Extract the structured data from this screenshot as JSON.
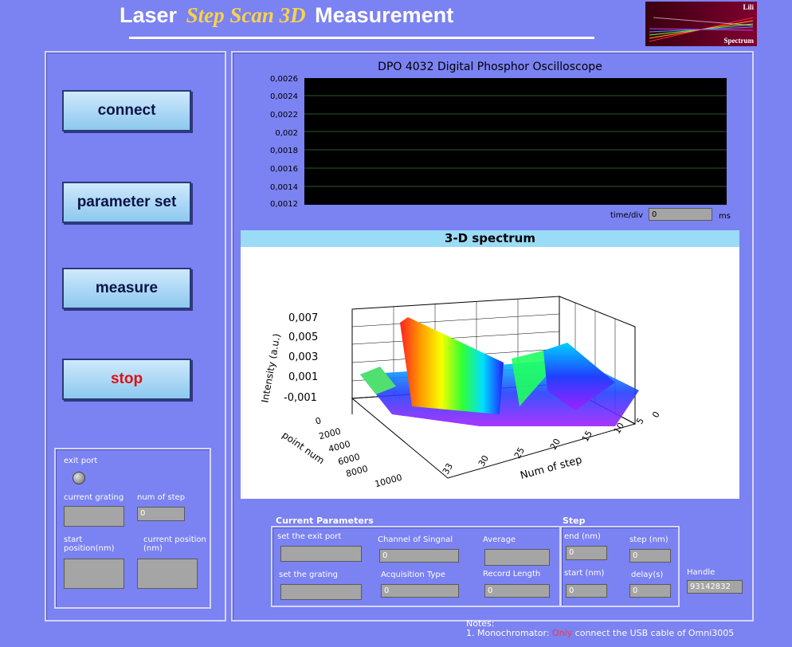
{
  "title": {
    "part1": "Laser",
    "part2": "Step Scan 3D",
    "part3": "Measurement"
  },
  "logo": {
    "line1": "Lili",
    "line2": "Spectrum"
  },
  "buttons": {
    "connect": "connect",
    "parameter_set": "parameter set",
    "measure": "measure",
    "stop": "stop"
  },
  "status": {
    "exit_port_label": "exit port",
    "current_grating_label": "current grating",
    "current_grating_value": "",
    "num_of_step_label": "num of step",
    "num_of_step_value": "0",
    "start_position_label": "start position(nm)",
    "start_position_value": "",
    "current_position_label": "current position (nm)",
    "current_position_value": ""
  },
  "oscilloscope": {
    "title": "DPO 4032 Digital Phosphor Oscilloscope",
    "y_ticks": [
      "0,0026",
      "0,0024",
      "0,0022",
      "0,002",
      "0,0018",
      "0,0016",
      "0,0014",
      "0,0012"
    ],
    "timediv_label": "time/div",
    "timediv_value": "0",
    "timediv_unit": "ms"
  },
  "spectrum": {
    "title": "3-D spectrum",
    "z_ticks": [
      "0,007",
      "0,005",
      "0,003",
      "0,001",
      "-0,001"
    ],
    "z_label": "Intensity (a.u.)",
    "x_ticks": [
      "0",
      "2000",
      "4000",
      "6000",
      "8000",
      "10000"
    ],
    "x_label": "point num",
    "step_ticks": [
      "33",
      "30",
      "25",
      "20",
      "15",
      "10",
      "5",
      "0"
    ],
    "step_label": "Num of step"
  },
  "params": {
    "header": "Current Parameters",
    "exit_port_label": "set the exit port",
    "exit_port_value": "",
    "channel_label": "Channel of Singnal",
    "channel_value": "0",
    "average_label": "Average",
    "average_value": "",
    "grating_label": "set the grating",
    "grating_value": "",
    "acq_type_label": "Acquisition Type",
    "acq_type_value": "0",
    "record_length_label": "Record Length",
    "record_length_value": "0"
  },
  "step": {
    "header": "Step",
    "end_label": "end (nm)",
    "end_value": "0",
    "step_label": "step (nm)",
    "step_value": "0",
    "start_label": "start (nm)",
    "start_value": "0",
    "delay_label": "delay(s)",
    "delay_value": "0"
  },
  "handle": {
    "label": "Handle",
    "value": "93142832"
  },
  "notes": {
    "header": "Notes:",
    "line1_pre": "1. Monochromator: ",
    "line1_red": "Only",
    "line1_post": " connect the USB cable of Omni3005"
  },
  "colors": {
    "background": "#7b82f2",
    "title_accent": "#f7d34a",
    "stop_text": "#e01010"
  }
}
